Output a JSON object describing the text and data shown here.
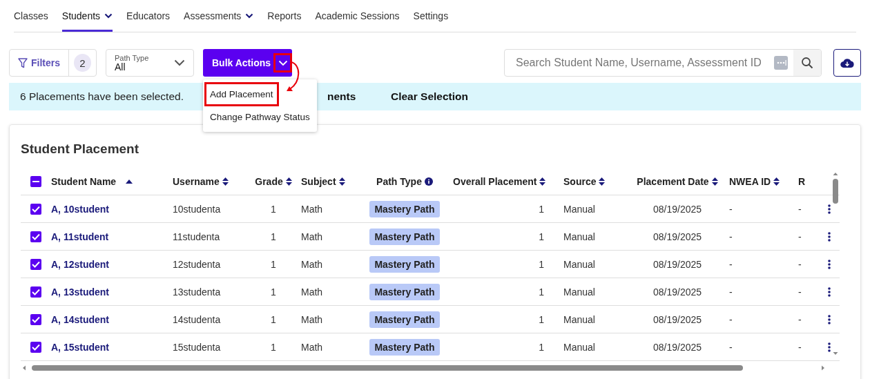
{
  "nav": [
    {
      "label": "Classes",
      "selected": false,
      "dropdown": false
    },
    {
      "label": "Students",
      "selected": true,
      "dropdown": true
    },
    {
      "label": "Educators",
      "selected": false,
      "dropdown": false
    },
    {
      "label": "Assessments",
      "selected": false,
      "dropdown": true
    },
    {
      "label": "Reports",
      "selected": false,
      "dropdown": false
    },
    {
      "label": "Academic Sessions",
      "selected": false,
      "dropdown": false
    },
    {
      "label": "Settings",
      "selected": false,
      "dropdown": false
    }
  ],
  "toolbar": {
    "filters": {
      "label": "Filters",
      "count": "2"
    },
    "path_type": {
      "label": "Path Type",
      "value": "All"
    },
    "bulk_actions": {
      "label": "Bulk Actions",
      "expanded": true,
      "highlighted": true
    },
    "bulk_menu": [
      {
        "label": "Add Placement",
        "highlighted": true
      },
      {
        "label": "Change Pathway Status",
        "highlighted": false
      }
    ],
    "search": {
      "placeholder": "Search Student Name, Username, Assessment ID"
    }
  },
  "banner": {
    "message": "6 Placements have been selected.",
    "actions": [
      "nents",
      "Clear Selection"
    ]
  },
  "table": {
    "title": "Student Placement",
    "select_all": {
      "checked": true,
      "indeterminate": true
    },
    "columns": [
      {
        "label": "Student Name",
        "sortable": true,
        "sorted": true,
        "info": false
      },
      {
        "label": "Username",
        "sortable": true,
        "sorted": false,
        "info": false
      },
      {
        "label": "Grade",
        "sortable": true,
        "sorted": false,
        "info": false
      },
      {
        "label": "Subject",
        "sortable": true,
        "sorted": false,
        "info": false
      },
      {
        "label": "Path Type",
        "sortable": false,
        "info": true
      },
      {
        "label": "Overall Placement",
        "sortable": true,
        "sorted": false,
        "info": false
      },
      {
        "label": "Source",
        "sortable": true,
        "sorted": false,
        "info": false
      },
      {
        "label": "Placement Date",
        "sortable": true,
        "sorted": false,
        "info": false
      },
      {
        "label": "NWEA ID",
        "sortable": true,
        "sorted": false,
        "info": false
      },
      {
        "label": "R"
      }
    ],
    "rows": [
      {
        "checked": true,
        "cells": [
          "A, 10student",
          "10studenta",
          "1",
          "Math",
          "Mastery Path",
          "1",
          "Manual",
          "08/19/2025",
          "-",
          "-"
        ]
      },
      {
        "checked": true,
        "cells": [
          "A, 11student",
          "11studenta",
          "1",
          "Math",
          "Mastery Path",
          "1",
          "Manual",
          "08/19/2025",
          "-",
          "-"
        ]
      },
      {
        "checked": true,
        "cells": [
          "A, 12student",
          "12studenta",
          "1",
          "Math",
          "Mastery Path",
          "1",
          "Manual",
          "08/19/2025",
          "-",
          "-"
        ]
      },
      {
        "checked": true,
        "cells": [
          "A, 13student",
          "13studenta",
          "1",
          "Math",
          "Mastery Path",
          "1",
          "Manual",
          "08/19/2025",
          "-",
          "-"
        ]
      },
      {
        "checked": true,
        "cells": [
          "A, 14student",
          "14studenta",
          "1",
          "Math",
          "Mastery Path",
          "1",
          "Manual",
          "08/19/2025",
          "-",
          "-"
        ]
      },
      {
        "checked": true,
        "cells": [
          "A, 15student",
          "15studenta",
          "1",
          "Math",
          "Mastery Path",
          "1",
          "Manual",
          "08/19/2025",
          "-",
          "-"
        ]
      }
    ]
  }
}
